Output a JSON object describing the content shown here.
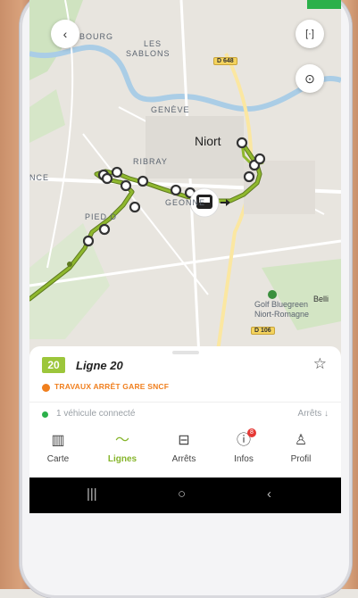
{
  "map": {
    "labels": [
      "BOURG",
      "LES",
      "SABLONS",
      "GENÈVE",
      "RIBRAY",
      "NCE",
      "PIED D",
      "D 648",
      "GEONNE"
    ],
    "city_label": "Niort",
    "golf_label_1": "Golf Bluegreen",
    "golf_label_2": "Niort-Romagne",
    "belli_label": "Belli",
    "road_badge_bottom": "D 106",
    "route_color": "#8fb82e"
  },
  "sheet": {
    "line_number": "20",
    "line_name": "Ligne 20",
    "alert": "TRAVAUX ARRÊT GARE SNCF",
    "vehicles": "1 véhicule connecté",
    "stops_link": "Arrêts ↓"
  },
  "nav": {
    "items": [
      {
        "label": "Carte",
        "icon": "map-icon"
      },
      {
        "label": "Lignes",
        "icon": "lines-icon"
      },
      {
        "label": "Arrêts",
        "icon": "bus-stop-icon"
      },
      {
        "label": "Infos",
        "icon": "info-icon",
        "badge": "8"
      },
      {
        "label": "Profil",
        "icon": "profile-icon"
      }
    ]
  },
  "colors": {
    "accent": "#86b52b",
    "line_badge": "#9cc63b",
    "alert": "#f07f1e",
    "connected": "#2bb04a"
  }
}
